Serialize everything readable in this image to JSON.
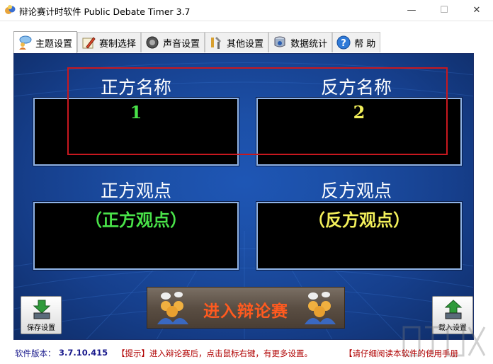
{
  "window": {
    "title": "辩论赛计时软件 Public Debate Timer 3.7",
    "minimize_glyph": "—",
    "maximize_glyph": "☐",
    "close_glyph": "✕"
  },
  "tabs": [
    {
      "label": "主题设置",
      "icon": "people-chat-icon",
      "active": true
    },
    {
      "label": "赛制选择",
      "icon": "pencil-icon",
      "active": false
    },
    {
      "label": "声音设置",
      "icon": "speaker-icon",
      "active": false
    },
    {
      "label": "其他设置",
      "icon": "tools-icon",
      "active": false
    },
    {
      "label": "数据统计",
      "icon": "database-icon",
      "active": false
    },
    {
      "label": "帮  助",
      "icon": "help-icon",
      "active": false
    }
  ],
  "affirmative": {
    "name_label": "正方名称",
    "name_value": "1",
    "view_label": "正方观点",
    "view_value": "（正方观点）"
  },
  "negative": {
    "name_label": "反方名称",
    "name_value": "2",
    "view_label": "反方观点",
    "view_value": "（反方观点）"
  },
  "buttons": {
    "save_label": "保存设置",
    "load_label": "载入设置",
    "enter_label": "进入辩论赛"
  },
  "status": {
    "version_label": "软件版本：",
    "version_value": "3.7.10.415",
    "tip": "【提示】进入辩论赛后，点击鼠标右键，有更多设置。",
    "manual": "【请仔细阅读本软件的使用手册"
  },
  "colors": {
    "panel_blue": "#1c4fa6",
    "affirmative_text": "#49e249",
    "negative_text": "#f2ef5a",
    "highlight_red": "#c8181f",
    "enter_text": "#ff5a1f",
    "status_label": "#1a1a8c",
    "status_tip": "#b00000"
  }
}
